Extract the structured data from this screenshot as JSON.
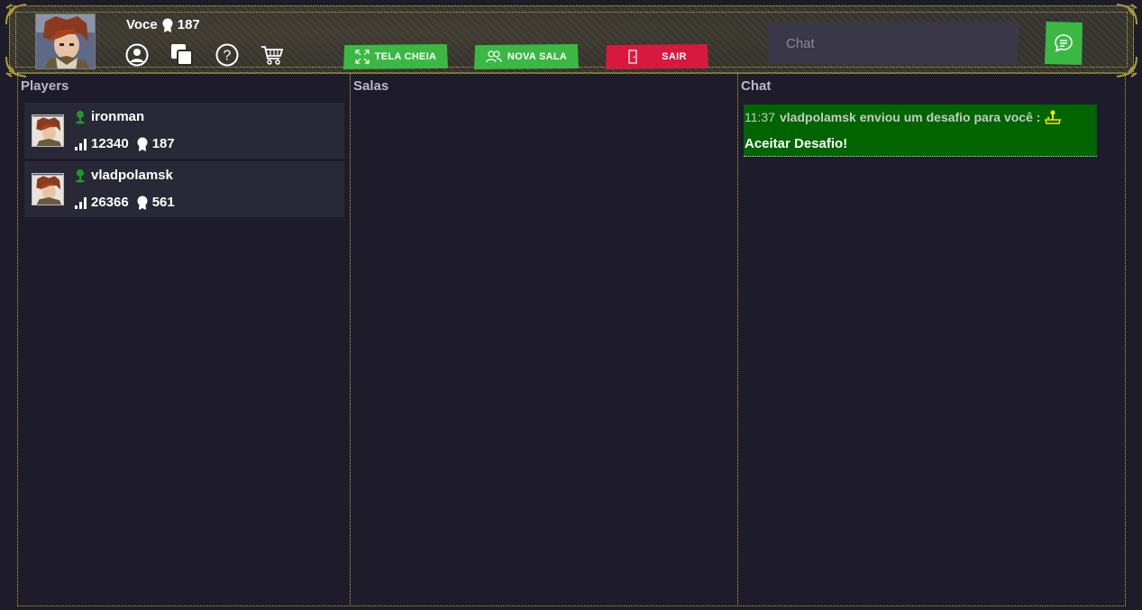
{
  "header": {
    "user_name": "Voce",
    "user_medals": "187",
    "icons": [
      "user-circle-icon",
      "windows-icon",
      "help-icon",
      "cart-icon"
    ],
    "buttons": {
      "fullscreen": "TELA CHEIA",
      "new_room": "NOVA SALA",
      "exit": "SAIR"
    },
    "chat_placeholder": "Chat"
  },
  "panels": {
    "players_title": "Players",
    "rooms_title": "Salas",
    "chat_title": "Chat"
  },
  "players": [
    {
      "name": "ironman",
      "rating": "12340",
      "medals": "187",
      "status": "online"
    },
    {
      "name": "vladpolamsk",
      "rating": "26366",
      "medals": "561",
      "status": "online"
    }
  ],
  "chat": {
    "messages": [
      {
        "time": "11:37",
        "text": "vladpolamsk enviou um desafio para você :",
        "icon": "joystick-icon",
        "action": "Aceitar Desafio!"
      }
    ]
  },
  "colors": {
    "background": "#1e1c2a",
    "green_button": "#3bb843",
    "red_button": "#d7193f",
    "challenge_bg": "#006400",
    "border_gold": "#b8ae3a",
    "online_green": "#1f9a2a",
    "joystick_yellow": "#f2e600"
  }
}
